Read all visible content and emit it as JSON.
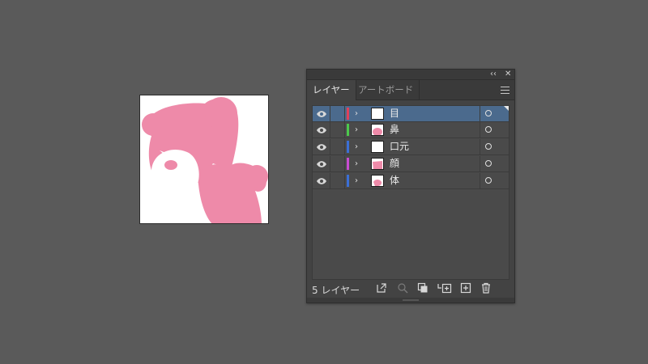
{
  "panel": {
    "tabs": [
      {
        "label": "レイヤー",
        "active": true
      },
      {
        "label": "アートボード",
        "active": false
      }
    ],
    "layers": [
      {
        "name": "目",
        "color": "#e0405a",
        "selected": true
      },
      {
        "name": "鼻",
        "color": "#4cc94c",
        "selected": false
      },
      {
        "name": "口元",
        "color": "#3b6fd6",
        "selected": false
      },
      {
        "name": "顔",
        "color": "#c84cd2",
        "selected": false
      },
      {
        "name": "体",
        "color": "#3b6fd6",
        "selected": false
      }
    ],
    "footer": {
      "count_label": "5 レイヤー"
    },
    "icons": {
      "collapse": "‹‹",
      "close": "✕"
    }
  },
  "colors": {
    "art_pink": "#ee8aa9",
    "canvas_bg": "#5a5a5a",
    "selection": "#4b6a8d"
  }
}
